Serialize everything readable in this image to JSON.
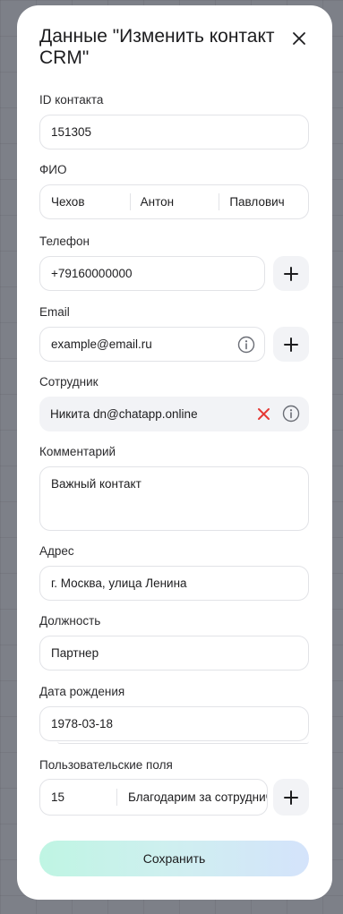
{
  "modal": {
    "title": "Данные \"Изменить контакт CRM\"",
    "close_icon": "close-icon"
  },
  "contact_id": {
    "label": "ID контакта",
    "value": "151305"
  },
  "full_name": {
    "label": "ФИО",
    "last_name": "Чехов",
    "first_name": "Антон",
    "middle_name": "Павлович"
  },
  "phone": {
    "label": "Телефон",
    "value": "+79160000000",
    "add_icon": "plus-icon"
  },
  "email": {
    "label": "Email",
    "value": "example@email.ru",
    "info_icon": "info-icon",
    "add_icon": "plus-icon"
  },
  "employee": {
    "label": "Сотрудник",
    "value": "Никита dn@chatapp.online",
    "remove_icon": "x-icon",
    "remove_color": "#e53935",
    "info_icon": "info-icon"
  },
  "comment": {
    "label": "Комментарий",
    "value": "Важный контакт"
  },
  "address": {
    "label": "Адрес",
    "value": "г. Москва, улица Ленина"
  },
  "position": {
    "label": "Должность",
    "value": "Партнер"
  },
  "birth_date": {
    "label": "Дата рождения",
    "value": "1978-03-18"
  },
  "custom_fields": {
    "label": "Пользовательские поля",
    "id_value": "15",
    "text_value": "Благодарим за сотрудничество",
    "add_icon": "plus-icon"
  },
  "save_button": {
    "label": "Сохранить"
  }
}
